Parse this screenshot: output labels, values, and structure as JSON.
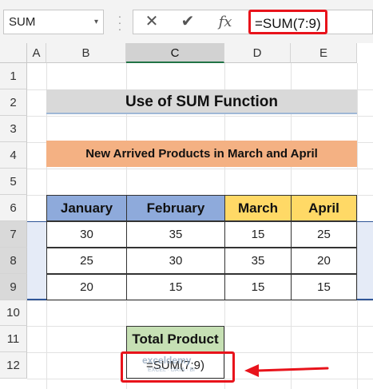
{
  "formula_bar": {
    "name_box": "SUM",
    "name_box_dropdown": "▾",
    "cancel_symbol": "✕",
    "enter_symbol": "✔",
    "fx_symbol": "fx",
    "formula": "=SUM(7:9)"
  },
  "columns": [
    "A",
    "B",
    "C",
    "D",
    "E"
  ],
  "rows": [
    "1",
    "2",
    "3",
    "4",
    "5",
    "6",
    "7",
    "8",
    "9",
    "10",
    "11",
    "12"
  ],
  "title": "Use of SUM Function",
  "subtitle": "New Arrived Products in March and April",
  "table": {
    "headers": [
      "January",
      "February",
      "March",
      "April"
    ],
    "rows": [
      [
        "30",
        "35",
        "15",
        "25"
      ],
      [
        "25",
        "30",
        "35",
        "20"
      ],
      [
        "20",
        "15",
        "15",
        "15"
      ]
    ]
  },
  "total": {
    "header": "Total Product",
    "value": "=SUM(7:9)"
  },
  "watermark": {
    "name": "exceldemy",
    "tagline": "EXCEL · DATA · BI"
  },
  "colors": {
    "accent_red": "#e8131b",
    "header_blue": "#8eaadb",
    "header_yellow": "#ffd966",
    "total_green": "#c6e0b4",
    "subtitle_orange": "#f4b183"
  }
}
